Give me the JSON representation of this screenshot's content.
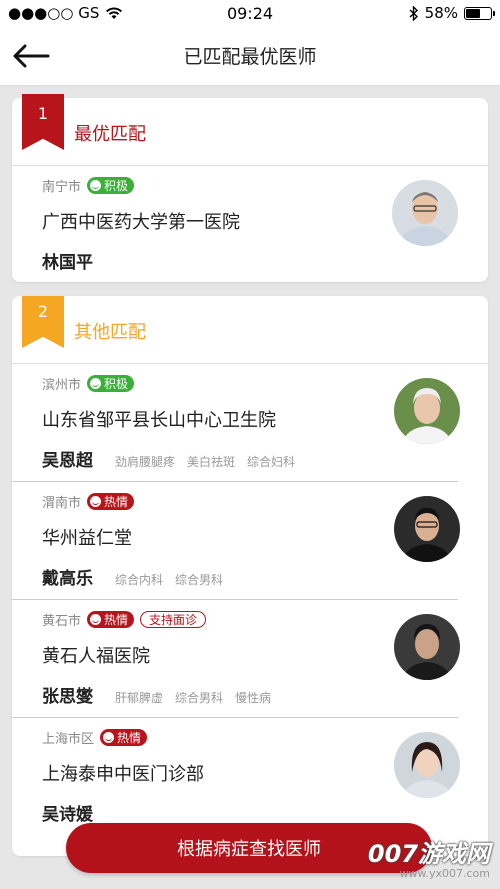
{
  "status_bar": {
    "carrier": "●●●○○ GS",
    "time": "09:24",
    "battery": "58%",
    "battery_level": 0.58
  },
  "nav": {
    "title": "已匹配最优医师"
  },
  "best": {
    "rank": "1",
    "title": "最优匹配",
    "doctor": {
      "city": "南宁市",
      "tag": "积极",
      "hospital": "广西中医药大学第一医院",
      "name": "林国平"
    }
  },
  "others": {
    "rank": "2",
    "title": "其他匹配",
    "doctors": [
      {
        "city": "滨州市",
        "tag": "积极",
        "hospital": "山东省邹平县长山中心卫生院",
        "name": "吴恩超",
        "specialties": [
          "劲肩腰腿疼",
          "美白祛斑",
          "综合妇科"
        ]
      },
      {
        "city": "渭南市",
        "tag": "热情",
        "hospital": "华州益仁堂",
        "name": "戴高乐",
        "specialties": [
          "综合内科",
          "综合男科"
        ]
      },
      {
        "city": "黄石市",
        "tag": "热情",
        "extra_tag": "支持面诊",
        "hospital": "黄石人福医院",
        "name": "张思燮",
        "specialties": [
          "肝郁脾虚",
          "综合男科",
          "慢性病"
        ]
      },
      {
        "city": "上海市区",
        "tag": "热情",
        "hospital": "上海泰申中医门诊部",
        "name": "吴诗媛"
      }
    ]
  },
  "bottom_button": "根据病症查找医师",
  "watermark": {
    "main": "007游戏网",
    "sub": "www.yx007.com"
  },
  "colors": {
    "brand_red": "#b8141c",
    "orange": "#f5a623",
    "green": "#3ab03a"
  }
}
